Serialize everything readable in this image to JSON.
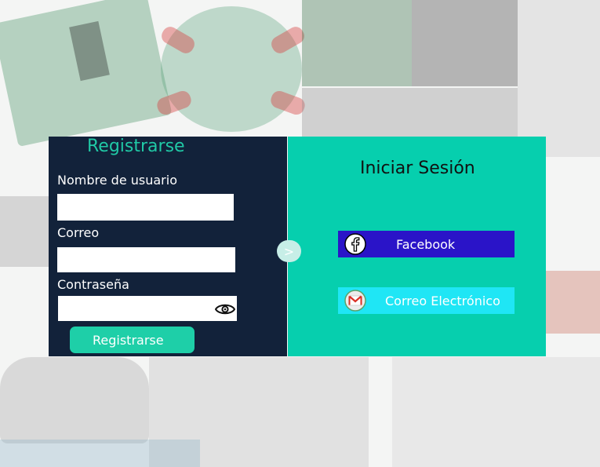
{
  "register": {
    "title": "Registrarse",
    "username_label": "Nombre de usuario",
    "username_value": "",
    "email_label": "Correo",
    "email_value": "",
    "password_label": "Contraseña",
    "password_value": "",
    "submit_label": "Registrarse",
    "show_password_icon": "eye-icon"
  },
  "toggle": {
    "glyph": ">"
  },
  "login": {
    "title": "Iniciar Sesión",
    "facebook_label": "Facebook",
    "email_label": "Correo Electrónico",
    "facebook_icon": "facebook-icon",
    "email_icon": "gmail-icon"
  },
  "colors": {
    "left_panel": "#12223a",
    "right_panel": "#06cfae",
    "accent_teal": "#20c9a6",
    "facebook_button": "#2a14c8",
    "email_button": "#1fe6f5"
  }
}
